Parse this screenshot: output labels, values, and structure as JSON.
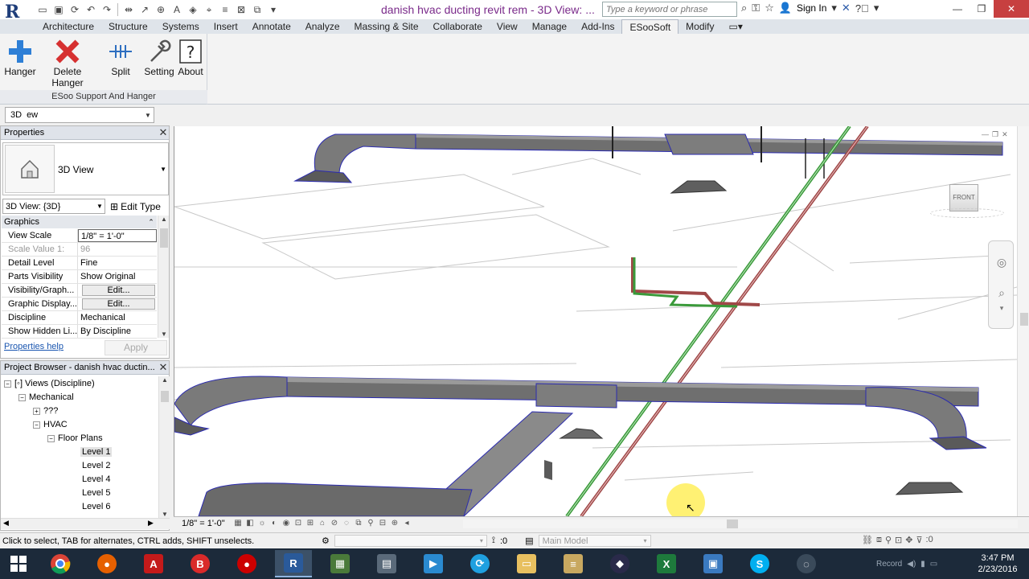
{
  "titlebar": {
    "app_logo": "R",
    "title": "danish hvac ducting revit rem - 3D View: ...",
    "search_placeholder": "Type a keyword or phrase",
    "signin_label": "Sign In"
  },
  "ribbon": {
    "tabs": [
      "Architecture",
      "Structure",
      "Systems",
      "Insert",
      "Annotate",
      "Analyze",
      "Massing & Site",
      "Collaborate",
      "View",
      "Manage",
      "Add-Ins",
      "ESooSoft",
      "Modify"
    ],
    "active_tab": "ESooSoft",
    "buttons": {
      "hanger": "Hanger",
      "delete_hanger": "Delete Hanger",
      "split": "Split",
      "setting": "Setting",
      "about": "About"
    },
    "panel_title": "ESoo Support And Hanger"
  },
  "view_selector": {
    "prefix": "3D",
    "value": "ew"
  },
  "properties": {
    "title": "Properties",
    "type_name": "3D View",
    "instance_selector": "3D View: {3D}",
    "edit_type_label": "Edit Type",
    "group_label": "Graphics",
    "rows": [
      {
        "key": "View Scale",
        "value": "1/8\" = 1'-0\""
      },
      {
        "key": "Scale Value    1:",
        "value": "96"
      },
      {
        "key": "Detail Level",
        "value": "Fine"
      },
      {
        "key": "Parts Visibility",
        "value": "Show Original"
      },
      {
        "key": "Visibility/Graph...",
        "value": "Edit..."
      },
      {
        "key": "Graphic Display...",
        "value": "Edit..."
      },
      {
        "key": "Discipline",
        "value": "Mechanical"
      },
      {
        "key": "Show Hidden Li...",
        "value": "By Discipline"
      }
    ],
    "help_link": "Properties help",
    "apply_label": "Apply"
  },
  "browser": {
    "title": "Project Browser - danish hvac ductin...",
    "nodes": {
      "views": "Views (Discipline)",
      "mechanical": "Mechanical",
      "unknown": "???",
      "hvac": "HVAC",
      "floor_plans": "Floor Plans",
      "level1": "Level 1",
      "level2": "Level 2",
      "level4": "Level 4",
      "level5": "Level 5",
      "level6": "Level 6"
    }
  },
  "viewport": {
    "viewcube_label": "FRONT"
  },
  "view_control": {
    "scale": "1/8\" = 1'-0\""
  },
  "status": {
    "text": "Click to select, TAB for alternates, CTRL adds, SHIFT unselects.",
    "count": ":0",
    "model": "Main Model",
    "filter_count": ":0"
  },
  "taskbar": {
    "time": "3:47 PM",
    "date": "2/23/2016",
    "tray_text": "Record"
  },
  "colors": {
    "title_purple": "#7a2a8a",
    "duct_gray": "#6f6f6f",
    "duct_outline": "#2b2bb0",
    "pipe_green": "#3a9a3a",
    "pipe_red": "#a04848",
    "taskbar": "#1c2a3a"
  }
}
